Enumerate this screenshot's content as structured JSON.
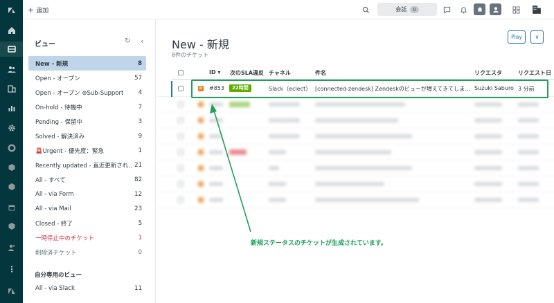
{
  "topbar": {
    "add_label": "追加",
    "conversations_label": "会話",
    "conversations_count": "0"
  },
  "views": {
    "title": "ビュー",
    "items": [
      {
        "label": "New - 新規",
        "count": "8",
        "active": true
      },
      {
        "label": "Open - オープン",
        "count": "57"
      },
      {
        "label": "Open - オープン ⊛Sub-Support",
        "count": "4"
      },
      {
        "label": "On-hold - 待機中",
        "count": "7"
      },
      {
        "label": "Pending - 保留中",
        "count": "3"
      },
      {
        "label": "Solved - 解決済み",
        "count": "9"
      },
      {
        "label": "🚨Urgent - 優先度：緊急",
        "count": "1"
      },
      {
        "label": "Recently updated - 直近更新され…",
        "count": "21"
      },
      {
        "label": "All - すべて",
        "count": "82"
      },
      {
        "label": "All - via Form",
        "count": "12"
      },
      {
        "label": "All - via Mail",
        "count": "23"
      },
      {
        "label": "Closed - 終了",
        "count": "5"
      },
      {
        "label": "一時停止中のチケット",
        "count": "1",
        "style": "paused"
      },
      {
        "label": "削除済チケット",
        "count": "0",
        "style": "deleted"
      }
    ],
    "personal_title": "自分専用のビュー",
    "personal_items": [
      {
        "label": "All - via Slack",
        "count": "11"
      }
    ]
  },
  "main": {
    "title": "New - 新規",
    "subtitle": "8件のチケット",
    "play_label": "Play",
    "more_label": "∨",
    "columns": {
      "id": "ID ▾",
      "sla": "次のSLA違反",
      "channel": "チャネル",
      "subject": "件名",
      "requester": "リクエスタ",
      "requested": "リクエスト日"
    },
    "first_row": {
      "status": "新",
      "id": "#853",
      "sla": "22時間",
      "channel": "Slack（eclect）",
      "subject": "[connected-zendesk] Zendeskのビューが増えてきてしま...",
      "requester": "Suzuki Saburo",
      "requested": "3 分前"
    }
  },
  "annotation": {
    "note": "新規ステータスのチケットが生成されています。",
    "color": "#1e9f5a"
  },
  "colors": {
    "rail": "#03363d",
    "accent": "#1f73b7",
    "status_new": "#e38215",
    "sla_green": "#5eae00"
  }
}
